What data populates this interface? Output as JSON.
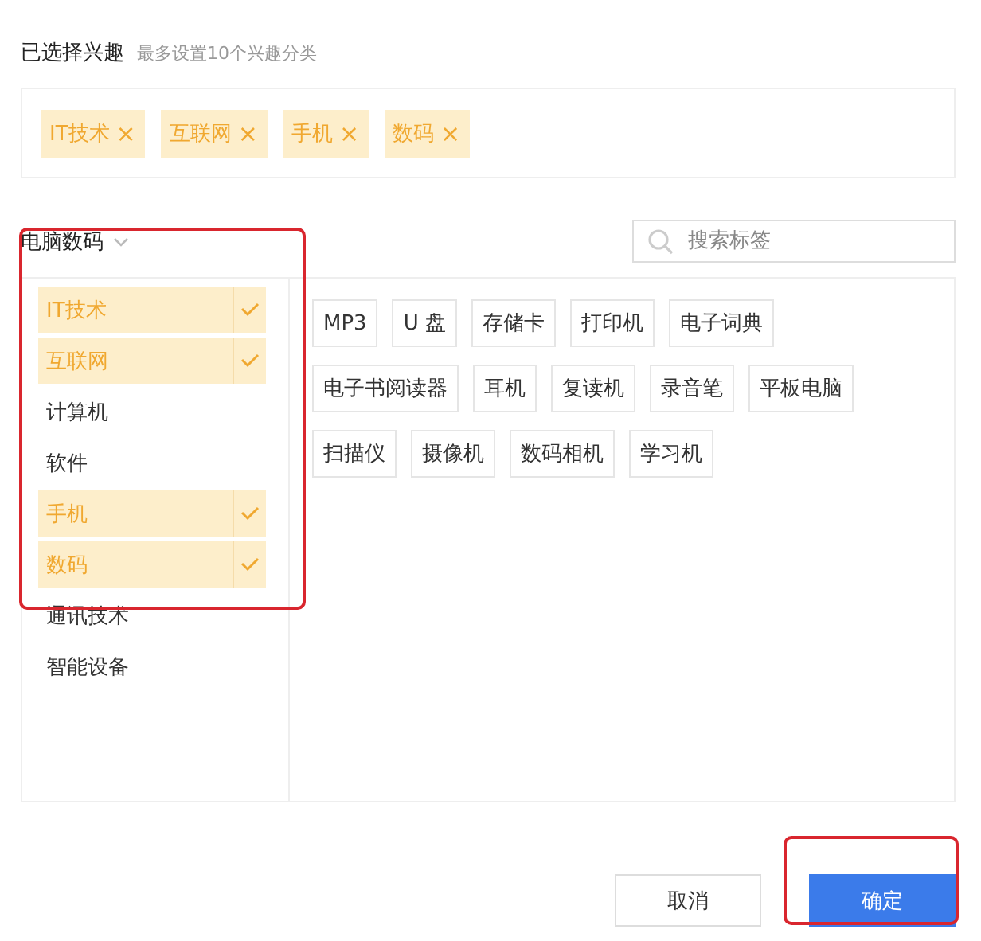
{
  "header": {
    "title": "已选择兴趣",
    "hint": "最多设置10个兴趣分类"
  },
  "selected_tags": [
    {
      "label": "IT技术",
      "remove": "×"
    },
    {
      "label": "互联网",
      "remove": "×"
    },
    {
      "label": "手机",
      "remove": "×"
    },
    {
      "label": "数码",
      "remove": "×"
    }
  ],
  "category": {
    "label": "电脑数码"
  },
  "search": {
    "placeholder": "搜索标签"
  },
  "subcategories": [
    {
      "label": "IT技术",
      "selected": true
    },
    {
      "label": "互联网",
      "selected": true
    },
    {
      "label": "计算机",
      "selected": false
    },
    {
      "label": "软件",
      "selected": false
    },
    {
      "label": "手机",
      "selected": true
    },
    {
      "label": "数码",
      "selected": true
    },
    {
      "label": "通讯技术",
      "selected": false
    },
    {
      "label": "智能设备",
      "selected": false
    }
  ],
  "tags": [
    "MP3",
    "U 盘",
    "存储卡",
    "打印机",
    "电子词典",
    "电子书阅读器",
    "耳机",
    "复读机",
    "录音笔",
    "平板电脑",
    "扫描仪",
    "摄像机",
    "数码相机",
    "学习机"
  ],
  "buttons": [
    {
      "label": "取消",
      "kind": "secondary"
    },
    {
      "label": "确定",
      "kind": "primary"
    }
  ]
}
